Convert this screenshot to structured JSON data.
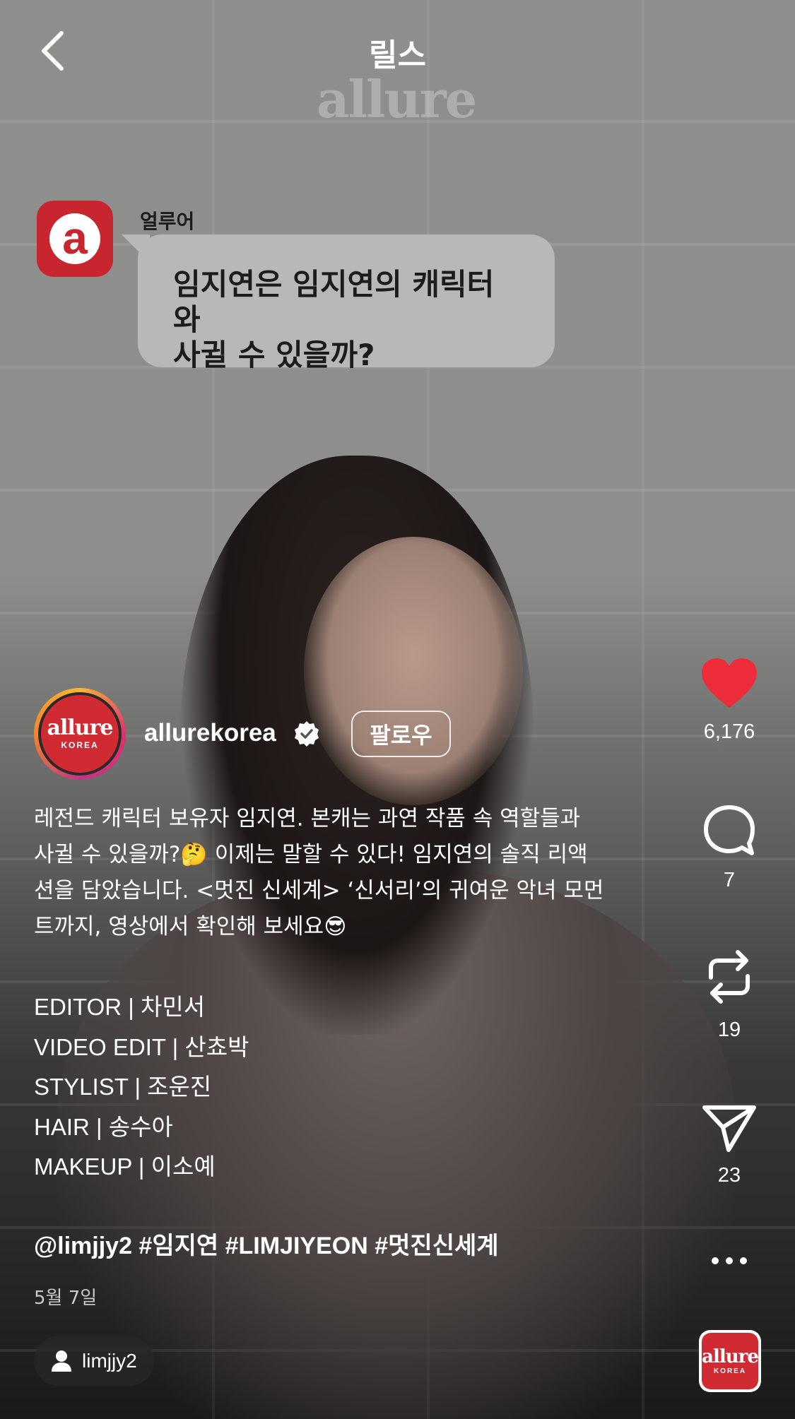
{
  "header": {
    "title": "릴스"
  },
  "video": {
    "watermark": "allure",
    "bubble_sender": "얼루어",
    "bubble_line1": "임지연은 임지연의 캐릭터와",
    "bubble_line2": "사귈 수 있을까?"
  },
  "author": {
    "username": "allurekorea",
    "verified": true,
    "follow_label": "팔로우",
    "avatar_logo": "allure",
    "avatar_logo_sub": "KOREA"
  },
  "actions": {
    "likes": "6,176",
    "comments": "7",
    "reposts": "19",
    "shares": "23",
    "like_color": "#ee2d3a"
  },
  "caption": {
    "line1": "레전드 캐릭터 보유자 임지연. 본캐는 과연 작품 속 역할들과",
    "line2a": "사귈 수 있을까?",
    "emoji1": "🤔",
    "line2b": " 이제는 말할 수 있다! 임지연의 솔직 리액",
    "line3": "션을 담았습니다. <멋진 신세계> ‘신서리’의 귀여운 악녀 모먼",
    "line4": "트까지, 영상에서 확인해 보세요",
    "emoji2": "😎"
  },
  "credits": [
    "EDITOR | 차민서",
    "VIDEO EDIT | 산쵸박",
    "STYLIST | 조운진",
    "HAIR | 송수아",
    "MAKEUP | 이소예"
  ],
  "tags": "@limjjy2 #임지연 #LIMJIYEON #멋진신세계",
  "date": "5월 7일",
  "tagged_user": "limjjy2",
  "audio": {
    "logo": "allure",
    "logo_sub": "KOREA"
  }
}
